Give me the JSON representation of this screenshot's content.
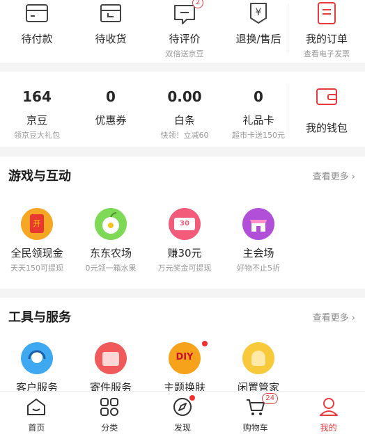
{
  "orders": {
    "items": [
      {
        "label": "待付款",
        "sub": "",
        "icon": "wallet-card-icon"
      },
      {
        "label": "待收货",
        "sub": "",
        "icon": "package-box-icon"
      },
      {
        "label": "待评价",
        "sub": "双倍送京豆",
        "icon": "comment-icon",
        "badge": "2"
      },
      {
        "label": "退换/售后",
        "sub": "",
        "icon": "return-yuan-icon"
      }
    ],
    "my_orders": {
      "label": "我的订单",
      "sub": "查看电子发票",
      "icon": "order-list-icon"
    }
  },
  "wallet": {
    "items": [
      {
        "value": "164",
        "label": "京豆",
        "sub": "领京豆大礼包"
      },
      {
        "value": "0",
        "label": "优惠券",
        "sub": ""
      },
      {
        "value": "0.00",
        "label": "白条",
        "sub": "快领！立减60"
      },
      {
        "value": "0",
        "label": "礼品卡",
        "sub": "超市卡送150元"
      }
    ],
    "my_wallet": {
      "label": "我的钱包",
      "icon": "wallet-icon"
    }
  },
  "games": {
    "title": "游戏与互动",
    "more": "查看更多 ›",
    "items": [
      {
        "label": "全民领现金",
        "sub": "天天150可提现",
        "icon": "red-envelope-icon",
        "glyph": "开",
        "color": "#f5a623"
      },
      {
        "label": "东东农场",
        "sub": "0元领一箱水果",
        "icon": "apple-icon",
        "glyph": "",
        "color": "#7ed957"
      },
      {
        "label": "赚30元",
        "sub": "万元奖金可提现",
        "icon": "cash-icon",
        "glyph": "30",
        "color": "#f25c7a"
      },
      {
        "label": "主会场",
        "sub": "好物不止5折",
        "icon": "store-icon",
        "glyph": "",
        "color": "#b14fd8"
      }
    ]
  },
  "tools": {
    "title": "工具与服务",
    "more": "查看更多 ›",
    "items": [
      {
        "label": "客户服务",
        "icon": "headset-icon",
        "color": "#3ea8f0"
      },
      {
        "label": "寄件服务",
        "icon": "mail-box-icon",
        "color": "#f05a5a"
      },
      {
        "label": "主题换肤",
        "icon": "diy-icon",
        "color": "#f7a21b",
        "glyph": "DIY"
      },
      {
        "label": "闲置管家",
        "icon": "yuan-bag-icon",
        "color": "#f8c93a"
      }
    ]
  },
  "tabbar": {
    "items": [
      {
        "label": "首页",
        "icon": "home-icon"
      },
      {
        "label": "分类",
        "icon": "category-icon"
      },
      {
        "label": "发现",
        "icon": "discover-icon"
      },
      {
        "label": "购物车",
        "icon": "cart-icon",
        "badge": "24"
      },
      {
        "label": "我的",
        "icon": "profile-icon",
        "active": true
      }
    ],
    "active_color": "#e93b3d"
  }
}
